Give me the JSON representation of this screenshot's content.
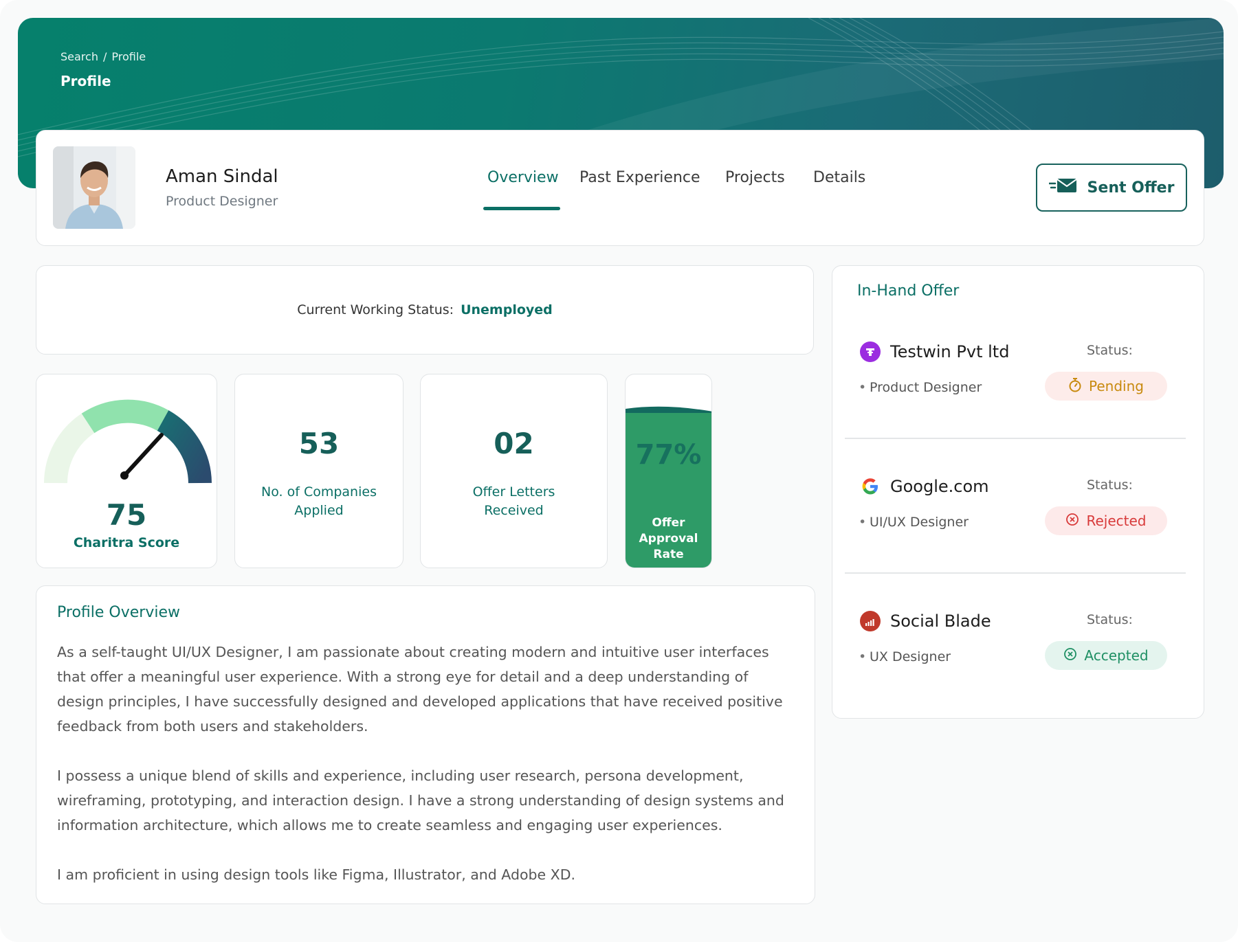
{
  "header": {
    "breadcrumb": [
      "Search",
      "Profile"
    ],
    "breadcrumb_sep": "/",
    "title": "Profile"
  },
  "profile": {
    "name": "Aman Sindal",
    "role": "Product Designer",
    "tabs": [
      "Overview",
      "Past Experience",
      "Projects",
      "Details"
    ],
    "active_tab": "Overview",
    "send_offer_label": "Sent Offer"
  },
  "working_status": {
    "label": "Current Working Status:",
    "value": "Unemployed"
  },
  "stats": {
    "score": {
      "value": "75",
      "label": "Charitra Score"
    },
    "companies": {
      "value": "53",
      "label_line1": "No. of Companies",
      "label_line2": "Applied"
    },
    "letters": {
      "value": "02",
      "label_line1": "Offer Letters",
      "label_line2": "Received"
    },
    "approval": {
      "value": "77%",
      "fill_percent": 77,
      "label_line1": "Offer",
      "label_line2": "Approval",
      "label_line3": "Rate"
    }
  },
  "overview": {
    "title": "Profile Overview",
    "paragraphs": [
      "As a self-taught UI/UX Designer, I am passionate about creating modern and intuitive user interfaces that offer a meaningful user experience. With a strong eye for detail and a deep understanding of design principles, I have successfully designed and developed applications that have received positive feedback from both users and stakeholders.",
      "I possess a unique blend of skills and experience, including user research, persona development, wireframing, prototyping, and interaction design. I have a strong understanding of design systems and information architecture, which allows me to create seamless and engaging user experiences.",
      "I am proficient in using design tools like Figma, Illustrator, and Adobe XD."
    ]
  },
  "offers": {
    "title": "In-Hand Offer",
    "items": [
      {
        "company": "Testwin Pvt ltd",
        "status_label": "Status:",
        "job": "Product Designer",
        "status": "Pending",
        "logo_icon": "testwin-logo-icon",
        "logo_color": "#9b2de0",
        "status_icon": "stopwatch-icon"
      },
      {
        "company": "Google.com",
        "status_label": "Status:",
        "job": "UI/UX Designer",
        "status": "Rejected",
        "logo_icon": "google-logo-icon",
        "status_icon": "x-circle-icon"
      },
      {
        "company": "Social Blade",
        "status_label": "Status:",
        "job": "UX Designer",
        "status": "Accepted",
        "logo_icon": "social-blade-logo-icon",
        "logo_color": "#c0392b",
        "status_icon": "check-circle-icon"
      }
    ]
  },
  "colors": {
    "primary": "#0b6f65",
    "banner_start": "#06806c",
    "banner_end": "#1d5d6c",
    "pending": "#c88a0e",
    "rejected": "#d83a3a",
    "accepted": "#1e8f63"
  }
}
